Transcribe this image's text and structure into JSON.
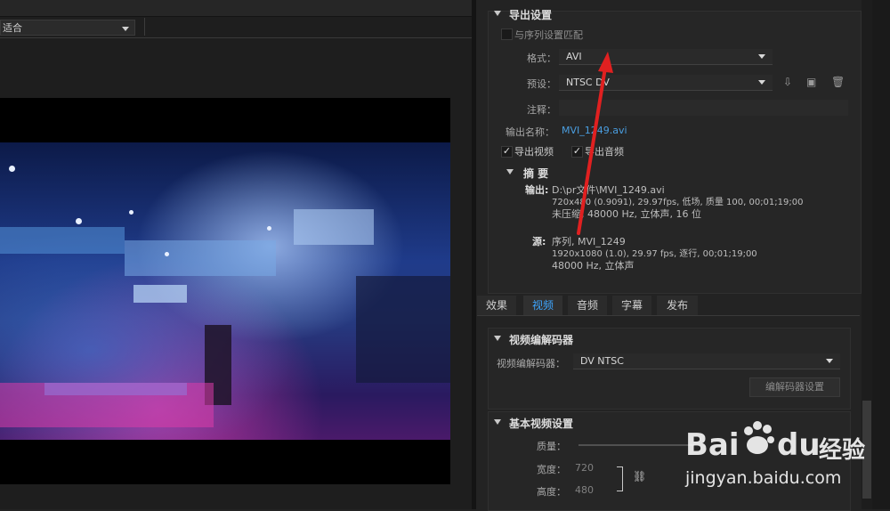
{
  "preview": {
    "fit_label": "适合"
  },
  "export_settings": {
    "title": "导出设置",
    "match_sequence_label": "与序列设置匹配",
    "format_label": "格式：",
    "format_value": "AVI",
    "preset_label": "预设：",
    "preset_value": "NTSC DV",
    "comment_label": "注释：",
    "output_name_label": "输出名称：",
    "output_name_value": "MVI_1249.avi",
    "export_video_label": "导出视频",
    "export_audio_label": "导出音频",
    "export_video_checked": true,
    "export_audio_checked": true
  },
  "summary": {
    "title": "摘 要",
    "output_label": "输出:",
    "output_lines": [
      "D:\\pr文件\\MVI_1249.avi",
      "720x480 (0.9091), 29.97fps, 低场, 质量 100, 00;01;19;00",
      "未压缩, 48000 Hz, 立体声, 16 位"
    ],
    "source_label": "源:",
    "source_lines": [
      "序列, MVI_1249",
      "1920x1080 (1.0), 29.97 fps, 逐行, 00;01;19;00",
      "48000 Hz, 立体声"
    ]
  },
  "tabs": [
    {
      "label": "效果",
      "active": false
    },
    {
      "label": "视频",
      "active": true
    },
    {
      "label": "音频",
      "active": false
    },
    {
      "label": "字幕",
      "active": false
    },
    {
      "label": "发布",
      "active": false
    }
  ],
  "video_codec": {
    "title": "视频编解码器",
    "codec_label": "视频编解码器：",
    "codec_value": "DV NTSC",
    "codec_settings_button": "编解码器设置"
  },
  "basic_video": {
    "title": "基本视频设置",
    "quality_label": "质量：",
    "width_label": "宽度：",
    "width_value": "720",
    "height_label": "高度：",
    "height_value": "480"
  },
  "watermark": {
    "brand": "Bai",
    "brand2": "du",
    "brand_cn": "经验",
    "url": "jingyan.baidu.com"
  },
  "colors": {
    "accent": "#3ea6ff",
    "arrow": "#e02020"
  }
}
